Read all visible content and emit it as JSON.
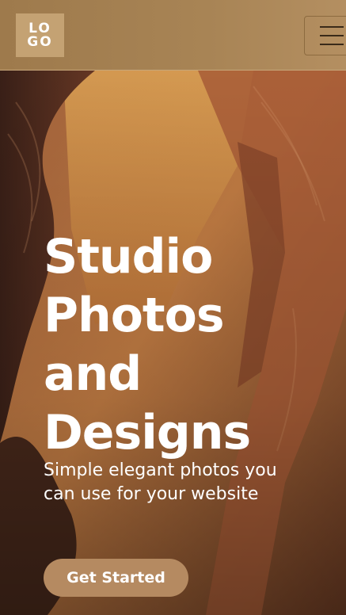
{
  "header": {
    "logo": {
      "line1": "LO",
      "line2": "GO"
    },
    "menu_icon": "hamburger-menu-icon"
  },
  "hero": {
    "background": "canyon-sandstone-photo",
    "title_lines": [
      "Studio",
      "Photos",
      "and",
      "Designs"
    ],
    "subtitle": "Simple elegant photos you can use for your website",
    "cta_label": "Get Started"
  },
  "colors": {
    "header_bg": "#a88455",
    "logo_bg": "#c4a273",
    "cta_bg": "#b58a61",
    "text": "#ffffff"
  }
}
